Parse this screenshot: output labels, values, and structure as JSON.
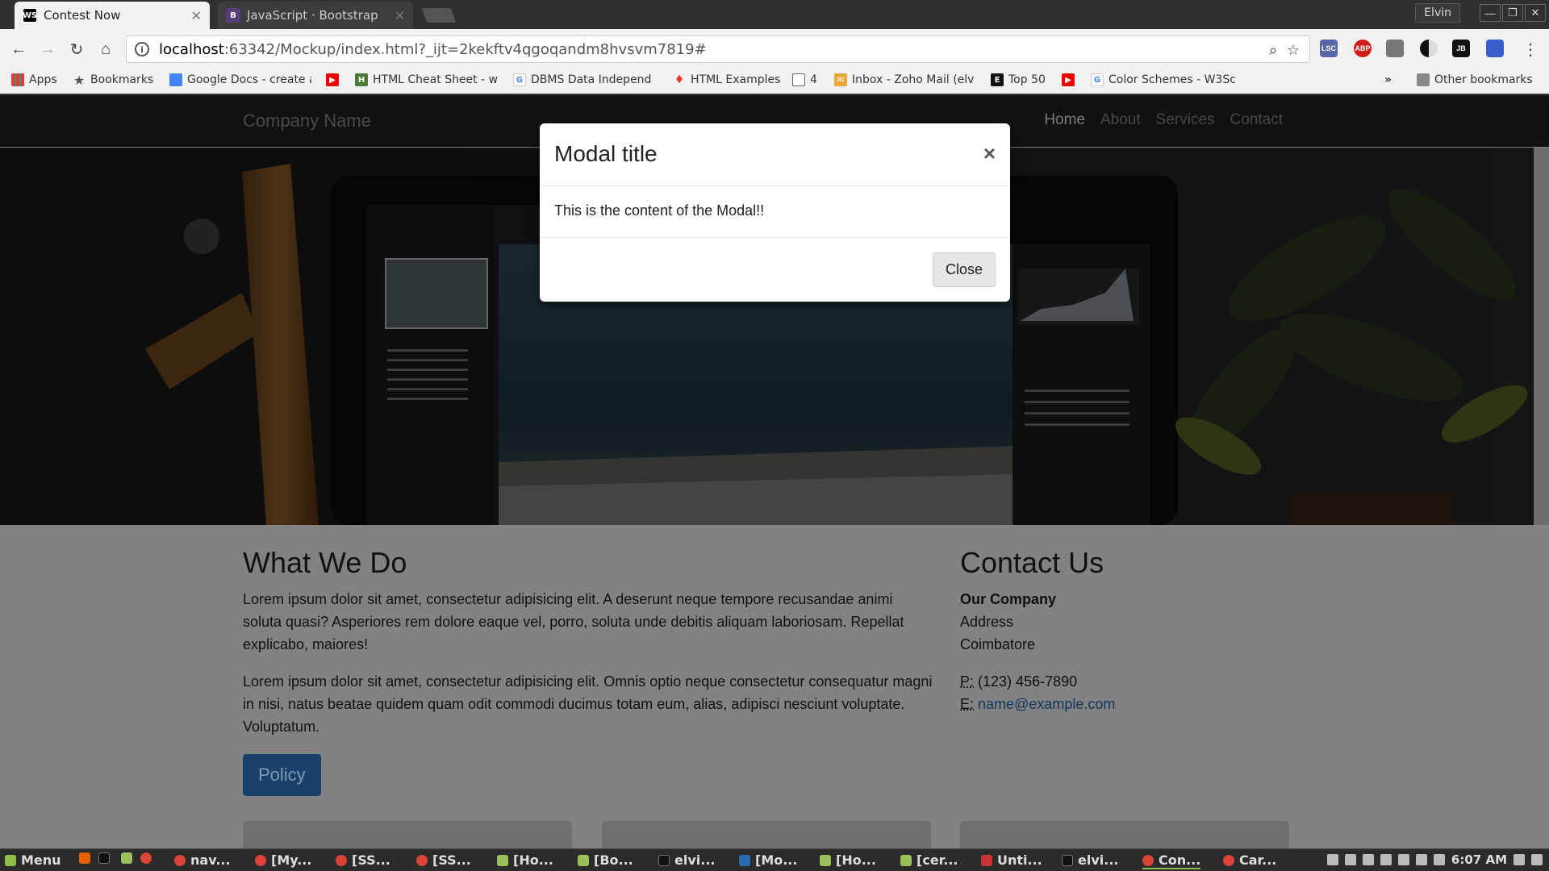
{
  "browser": {
    "tabs": [
      {
        "label": "Contest Now",
        "favicon": "WS",
        "active": true
      },
      {
        "label": "JavaScript · Bootstrap",
        "favicon": "B",
        "active": false
      }
    ],
    "user": "Elvin",
    "url_host": "localhost",
    "url_rest": ":63342/Mockup/index.html?_ijt=2kekftv4qgoqandm8hvsvm7819#",
    "extensions": [
      "LSC",
      "ABP",
      "JB"
    ],
    "bookmarks": [
      {
        "label": "Apps",
        "icon": "apps-grid-icon"
      },
      {
        "label": "Bookmarks",
        "icon": "star-icon"
      },
      {
        "label": "Google Docs - create a",
        "icon": "docs-icon"
      },
      {
        "label": "",
        "icon": "youtube-icon"
      },
      {
        "label": "HTML Cheat Sheet - w",
        "icon": "html-icon"
      },
      {
        "label": "DBMS Data Independ",
        "icon": "google-icon"
      },
      {
        "label": "HTML Examples",
        "icon": "fire-icon"
      },
      {
        "label": "4",
        "icon": "page-icon"
      },
      {
        "label": "Inbox - Zoho Mail (elv",
        "icon": "mail-icon"
      },
      {
        "label": "Top 50",
        "icon": "e-icon"
      },
      {
        "label": "",
        "icon": "youtube-icon"
      },
      {
        "label": "Color Schemes - W3Sc",
        "icon": "google-icon"
      }
    ],
    "bookmarks_overflow": "»",
    "other_bookmarks": "Other bookmarks"
  },
  "site": {
    "brand": "Company Name",
    "nav": [
      "Home",
      "About",
      "Services",
      "Contact"
    ],
    "what_we_do": {
      "heading": "What We Do",
      "para1": "Lorem ipsum dolor sit amet, consectetur adipisicing elit. A deserunt neque tempore recusandae animi soluta quasi? Asperiores rem dolore eaque vel, porro, soluta unde debitis aliquam laboriosam. Repellat explicabo, maiores!",
      "para2": "Lorem ipsum dolor sit amet, consectetur adipisicing elit. Omnis optio neque consectetur consequatur magni in nisi, natus beatae quidem quam odit commodi ducimus totam eum, alias, adipisci nesciunt voluptate. Voluptatum.",
      "button": "Policy"
    },
    "contact": {
      "heading": "Contact Us",
      "company": "Our Company",
      "address": "Address",
      "city": "Coimbatore",
      "phone_label": "P:",
      "phone": "(123) 456-7890",
      "email_label": "E:",
      "email": "name@example.com"
    }
  },
  "modal": {
    "title": "Modal title",
    "close_x": "×",
    "body": "This is the content of the Modal!!",
    "close_button": "Close"
  },
  "taskbar": {
    "menu": "Menu",
    "items": [
      "nav...",
      "[My...",
      "[SS...",
      "[SS...",
      "[Ho...",
      "[Bo...",
      "elvi...",
      "[Mo...",
      "[Ho...",
      "[cer...",
      "Unti...",
      "elvi...",
      "Con...",
      "Car..."
    ],
    "clock": "6:07 AM"
  },
  "colors": {
    "accent": "#19416b",
    "link": "#12375c",
    "navbar": "#111111",
    "overlay_page": "#828282"
  }
}
